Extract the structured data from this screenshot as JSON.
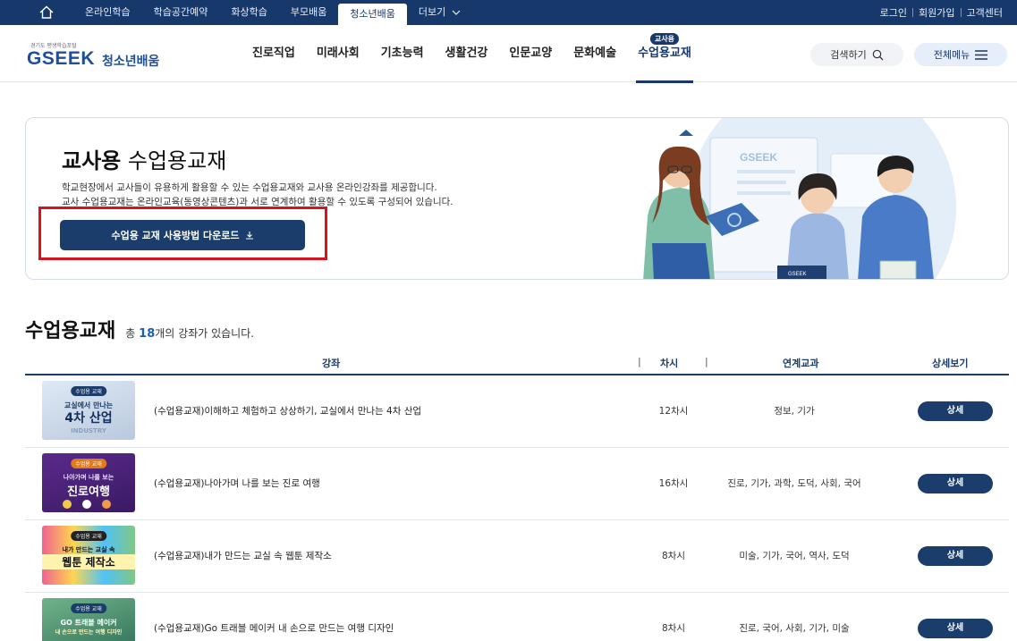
{
  "topbar": {
    "tabs": [
      "온라인학습",
      "학습공간예약",
      "화상학습",
      "부모배움",
      "청소년배움",
      "더보기"
    ],
    "active_tab": "청소년배움",
    "links": [
      "로그인",
      "회원가입",
      "고객센터"
    ]
  },
  "header": {
    "logo_small": "경기도 평생학습포털",
    "logo_brand": "GSEEK",
    "logo_sub": "청소년배움",
    "nav": [
      "진로직업",
      "미래사회",
      "기초능력",
      "생활건강",
      "인문교양",
      "문화예술",
      "수업용교재"
    ],
    "active_nav": "수업용교재",
    "active_badge": "교사용",
    "search_label": "검색하기",
    "menu_label": "전체메뉴"
  },
  "banner": {
    "title_bold": "교사용",
    "title_rest": "수업용교재",
    "desc_line1": "학교현장에서 교사들이 유용하게 활용할 수 있는 수업용교재와 교사용 온라인강좌를 제공합니다.",
    "desc_line2": "교사 수업용교재는 온라인교육(동영상콘텐츠)과 서로 연계하여 활용할 수 있도록 구성되어 있습니다.",
    "download_label": "수업용 교재 사용방법 다운로드",
    "illus_brand": "GSEEK",
    "book_label": "GSEEK"
  },
  "list": {
    "heading": "수업용교재",
    "count_prefix": "총",
    "count": "18",
    "count_suffix": "개의 강좌가 있습니다.",
    "columns": [
      "강좌",
      "차시",
      "연계교과",
      "상세보기"
    ],
    "rows": [
      {
        "thumb_tag": "수업용 교재",
        "thumb_line1": "교실에서 만나는",
        "thumb_line2": "4차 산업",
        "thumb_line3": "INDUSTRY",
        "title": "(수업용교재)이해하고 체험하고 상상하기, 교실에서 만나는 4차 산업",
        "sessions": "12차시",
        "subjects": "정보, 기가",
        "button": "상세"
      },
      {
        "thumb_tag": "수업용 교재",
        "thumb_line1": "나아가며 나를 보는",
        "thumb_line2": "진로여행",
        "title": "(수업용교재)나아가며 나를 보는 진로 여행",
        "sessions": "16차시",
        "subjects": "진로, 기가, 과학, 도덕, 사회, 국어",
        "button": "상세"
      },
      {
        "thumb_tag": "수업용 교재",
        "thumb_line1": "내가 만드는 교실 속",
        "thumb_line2": "웹툰 제작소",
        "title": "(수업용교재)내가 만드는 교실 속 웹툰 제작소",
        "sessions": "8차시",
        "subjects": "미술, 기가, 국어, 역사, 도덕",
        "button": "상세"
      },
      {
        "thumb_tag": "수업용 교재",
        "thumb_line1": "GO 트래블 메이커",
        "thumb_line2": "내 손으로 만드는 여행 디자인",
        "title": "(수업용교재)Go 트래블 메이커 내 손으로 만드는 여행 디자인",
        "sessions": "8차시",
        "subjects": "진로, 국어, 사회, 기가, 미술",
        "button": "상세"
      }
    ]
  },
  "colors": {
    "navy": "#17386b",
    "button": "#1a3d6b",
    "highlight": "#d6141d",
    "accent_blue": "#1a5fb4"
  }
}
